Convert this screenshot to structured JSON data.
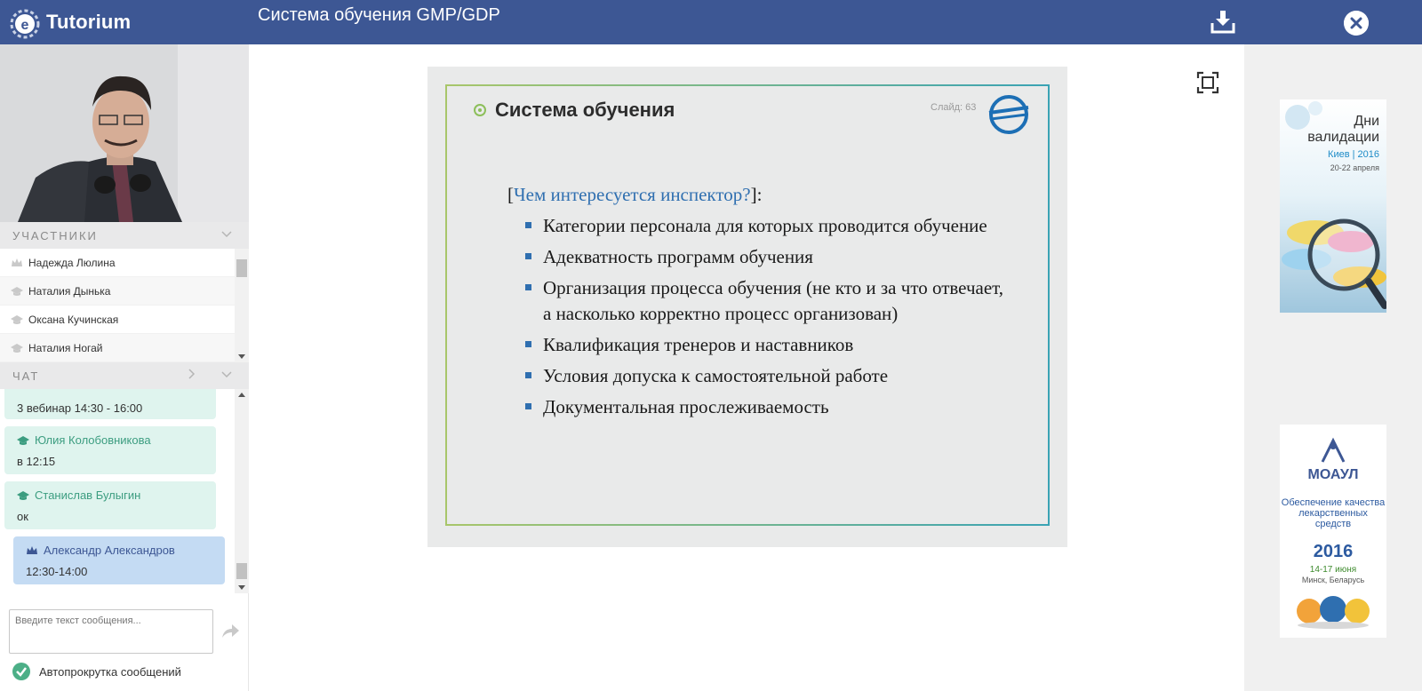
{
  "app": {
    "logo_text": "Tutorium",
    "logo_letter": "e",
    "title": "Система обучения GMP/GDP"
  },
  "participants": {
    "header": "УЧАСТНИКИ",
    "items": [
      {
        "name": "Надежда Люлина",
        "role": "crown"
      },
      {
        "name": "Наталия Дынька",
        "role": "student"
      },
      {
        "name": "Оксана Кучинская",
        "role": "student"
      },
      {
        "name": "Наталия Ногай",
        "role": "student"
      }
    ]
  },
  "chat": {
    "header": "ЧАТ",
    "messages": [
      {
        "author": "",
        "text": "3 вебинар 14:30 - 16:00",
        "style": "green"
      },
      {
        "author": "Юлия Колобовникова",
        "text": "в 12:15",
        "style": "green"
      },
      {
        "author": "Станислав Булыгин",
        "text": "ок",
        "style": "green"
      },
      {
        "author": "Александр Александров",
        "text": "12:30-14:00",
        "style": "blue"
      }
    ],
    "input_placeholder": "Введите текст сообщения...",
    "autoscroll_label": "Автопрокрутка сообщений"
  },
  "slide": {
    "title": "Система обучения",
    "number": "Слайд: 63",
    "question_prefix": "[",
    "question": "Чем интересуется инспектор?",
    "question_suffix": "]:",
    "bullets": [
      "Категории персонала для которых проводится обучение",
      "Адекватность программ обучения",
      "Организация процесса обучения (не кто и за что отвечает, а насколько корректно процесс организован)",
      "Квалификация тренеров и наставников",
      "Условия допуска к самостоятельной работе",
      "Документальная прослеживаемость"
    ]
  },
  "ads": {
    "ad1": {
      "line1": "Дни",
      "line2": "валидации",
      "city_year": "Киев | 2016",
      "dates": "20-22 апреля"
    },
    "ad2": {
      "brand": "МОАУЛ",
      "subtitle": "Обеспечение качества лекарственных средств",
      "year": "2016",
      "dates": "14-17 июня",
      "place": "Минск, Беларусь"
    }
  },
  "colors": {
    "topbar": "#3d5794",
    "accent_green": "#3c9d80",
    "chat_green_bg": "#dff4ee",
    "chat_blue_bg": "#c4dbf3"
  }
}
